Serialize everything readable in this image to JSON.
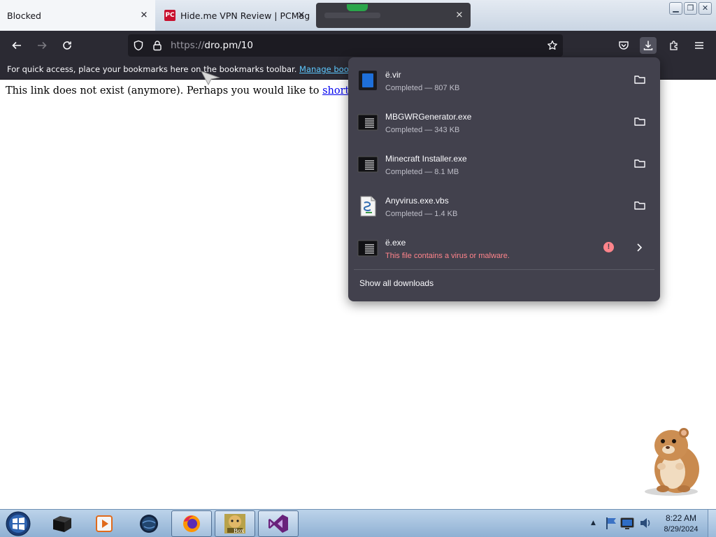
{
  "tabs": [
    {
      "label": "Blocked",
      "active": true
    },
    {
      "label": "Hide.me VPN Review | PCMag",
      "active": false
    },
    {
      "label": "",
      "active": false
    }
  ],
  "pcmag_favicon": "PC",
  "navbar": {
    "url_scheme": "https://",
    "url_host": "dro.pm/10"
  },
  "bookmarks_bar": {
    "message": "For quick access, place your bookmarks here on the bookmarks toolbar.",
    "link": "Manage bookmarks..."
  },
  "page": {
    "message": "This link does not exist (anymore). Perhaps you would like to",
    "link": "shorten your o"
  },
  "downloads": {
    "items": [
      {
        "name": "ë.vir",
        "status": "Completed — 807 KB",
        "icon": "blue-doc-icon",
        "action": "folder"
      },
      {
        "name": "MBGWRGenerator.exe",
        "status": "Completed — 343 KB",
        "icon": "exe-icon",
        "action": "folder"
      },
      {
        "name": "Minecraft Installer.exe",
        "status": "Completed — 8.1 MB",
        "icon": "exe-icon",
        "action": "folder"
      },
      {
        "name": "Anyvirus.exe.vbs",
        "status": "Completed — 1.4 KB",
        "icon": "script-icon",
        "action": "folder"
      },
      {
        "name": "ë.exe",
        "status": "This file contains a virus or malware.",
        "icon": "exe-icon",
        "action": "open",
        "danger": true
      }
    ],
    "show_all": "Show all downloads"
  },
  "taskbar": {
    "apps": [
      "terminal-app",
      "media-player-app",
      "globe-app",
      "firefox-app",
      "sandbox-app",
      "visual-studio-app"
    ],
    "sandbox_label": "Box",
    "time": "8:22 AM",
    "date": "8/29/2024"
  },
  "colors": {
    "toolbar": "#2b2a33",
    "panel": "#42414d",
    "danger": "#ff848b",
    "link": "#5ec9ff"
  }
}
